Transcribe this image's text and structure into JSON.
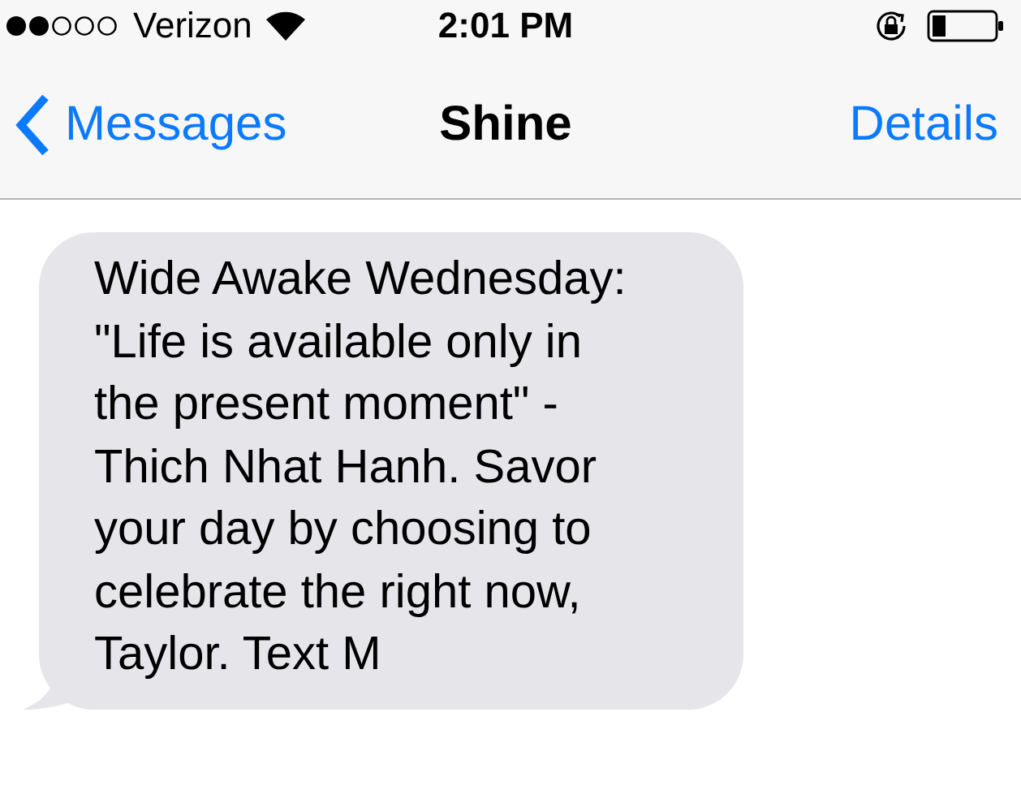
{
  "status_bar": {
    "carrier": "Verizon",
    "time": "2:01 PM"
  },
  "nav_bar": {
    "back": "Messages",
    "title": "Shine",
    "action": "Details"
  },
  "messages": [
    {
      "kind": "received",
      "text": "Wide Awake Wednesday:\n\"Life is available only in\nthe present moment\" -\nThich Nhat Hanh. Savor\nyour day by choosing to\ncelebrate the right now,\nTaylor. Text M"
    }
  ]
}
